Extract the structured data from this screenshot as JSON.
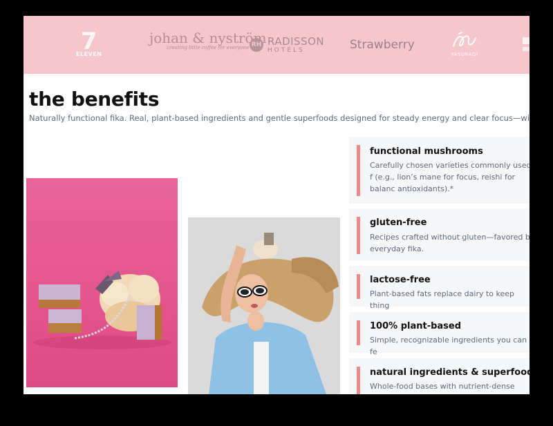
{
  "logos": {
    "seven_eleven": {
      "top": "7",
      "bottom": "ELEVEN"
    },
    "johan": {
      "name": "johan & nyström",
      "tagline": "creating little coffee for everyone"
    },
    "radisson": {
      "monogram": "RH",
      "name": "RADISSON",
      "sub": "HOTELS"
    },
    "strawberry": {
      "name": "Strawberry"
    },
    "yasuragi": {
      "name": "YASURAGI"
    }
  },
  "benefits": {
    "title": "the benefits",
    "intro": "Naturally functional fika. Real, plant-based ingredients and gentle superfoods designed for steady energy and clear focus—without added",
    "items": [
      {
        "name": "functional mushrooms",
        "desc": "Carefully chosen varieties commonly used f (e.g., lion’s mane for focus, reishi for balanc antioxidants).*"
      },
      {
        "name": "gluten-free",
        "desc": "Recipes crafted without gluten—favored by everyday fika."
      },
      {
        "name": "lactose-free",
        "desc": "Plant-based fats replace dairy to keep thing"
      },
      {
        "name": "100% plant-based",
        "desc": "Simple, recognizable ingredients you can fe"
      },
      {
        "name": "natural ingredients & superfoods",
        "desc": "Whole-food bases with nutrient-dense addit"
      }
    ]
  },
  "colors": {
    "logo_strip": "#f5c6cb",
    "accent_bar": "#f08a8a",
    "card_bg": "#f6f7f9",
    "photo_pink": "#e55a8f"
  }
}
